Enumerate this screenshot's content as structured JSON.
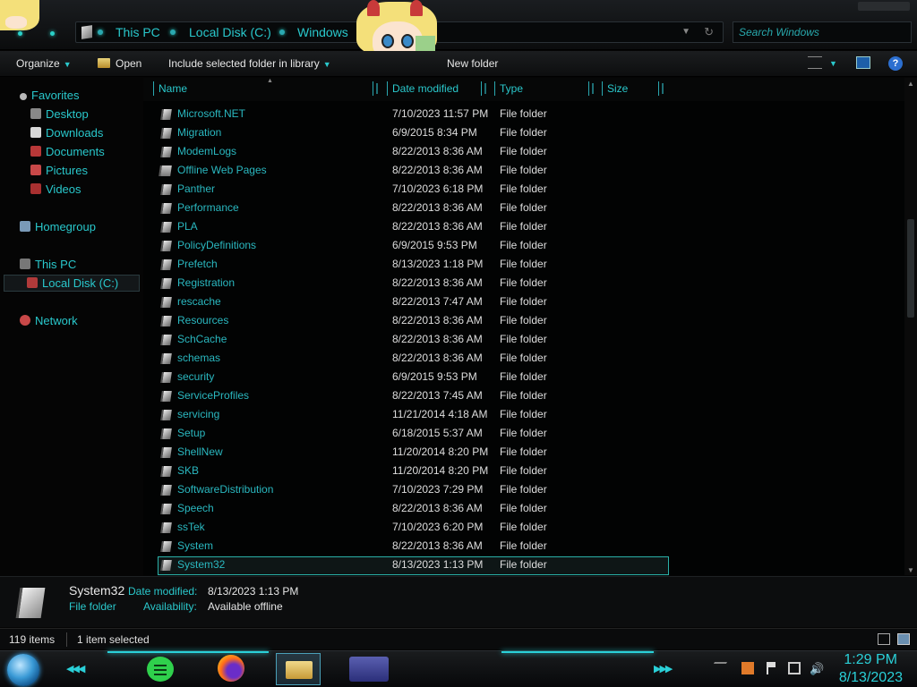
{
  "window": {
    "breadcrumb": [
      "This PC",
      "Local Disk (C:)",
      "Windows"
    ],
    "search_placeholder": "Search Windows"
  },
  "toolbar": {
    "organize": "Organize",
    "open": "Open",
    "include_library": "Include selected folder in library",
    "new_folder": "New folder"
  },
  "nav": {
    "favorites": "Favorites",
    "favorites_items": [
      "Desktop",
      "Downloads",
      "Documents",
      "Pictures",
      "Videos"
    ],
    "homegroup": "Homegroup",
    "this_pc": "This PC",
    "local_disk": "Local Disk (C:)",
    "network": "Network"
  },
  "columns": {
    "name": "Name",
    "date_modified": "Date modified",
    "type": "Type",
    "size": "Size"
  },
  "files": [
    {
      "name": "Microsoft.NET",
      "date": "7/10/2023 11:57 PM",
      "type": "File folder"
    },
    {
      "name": "Migration",
      "date": "6/9/2015 8:34 PM",
      "type": "File folder"
    },
    {
      "name": "ModemLogs",
      "date": "8/22/2013 8:36 AM",
      "type": "File folder"
    },
    {
      "name": "Offline Web Pages",
      "date": "8/22/2013 8:36 AM",
      "type": "File folder"
    },
    {
      "name": "Panther",
      "date": "7/10/2023 6:18 PM",
      "type": "File folder"
    },
    {
      "name": "Performance",
      "date": "8/22/2013 8:36 AM",
      "type": "File folder"
    },
    {
      "name": "PLA",
      "date": "8/22/2013 8:36 AM",
      "type": "File folder"
    },
    {
      "name": "PolicyDefinitions",
      "date": "6/9/2015 9:53 PM",
      "type": "File folder"
    },
    {
      "name": "Prefetch",
      "date": "8/13/2023 1:18 PM",
      "type": "File folder"
    },
    {
      "name": "Registration",
      "date": "8/22/2013 8:36 AM",
      "type": "File folder"
    },
    {
      "name": "rescache",
      "date": "8/22/2013 7:47 AM",
      "type": "File folder"
    },
    {
      "name": "Resources",
      "date": "8/22/2013 8:36 AM",
      "type": "File folder"
    },
    {
      "name": "SchCache",
      "date": "8/22/2013 8:36 AM",
      "type": "File folder"
    },
    {
      "name": "schemas",
      "date": "8/22/2013 8:36 AM",
      "type": "File folder"
    },
    {
      "name": "security",
      "date": "6/9/2015 9:53 PM",
      "type": "File folder"
    },
    {
      "name": "ServiceProfiles",
      "date": "8/22/2013 7:45 AM",
      "type": "File folder"
    },
    {
      "name": "servicing",
      "date": "11/21/2014 4:18 AM",
      "type": "File folder"
    },
    {
      "name": "Setup",
      "date": "6/18/2015 5:37 AM",
      "type": "File folder"
    },
    {
      "name": "ShellNew",
      "date": "11/20/2014 8:20 PM",
      "type": "File folder"
    },
    {
      "name": "SKB",
      "date": "11/20/2014 8:20 PM",
      "type": "File folder"
    },
    {
      "name": "SoftwareDistribution",
      "date": "7/10/2023 7:29 PM",
      "type": "File folder"
    },
    {
      "name": "Speech",
      "date": "8/22/2013 8:36 AM",
      "type": "File folder"
    },
    {
      "name": "ssTek",
      "date": "7/10/2023 6:20 PM",
      "type": "File folder"
    },
    {
      "name": "System",
      "date": "8/22/2013 8:36 AM",
      "type": "File folder"
    },
    {
      "name": "System32",
      "date": "8/13/2023 1:13 PM",
      "type": "File folder"
    }
  ],
  "selected_index": 24,
  "details": {
    "name": "System32",
    "type": "File folder",
    "date_label": "Date modified:",
    "date_value": "8/13/2023 1:13 PM",
    "availability_label": "Availability:",
    "availability_value": "Available offline"
  },
  "status": {
    "item_count": "119 items",
    "selection": "1 item selected"
  },
  "taskbar": {
    "time": "1:29 PM",
    "date": "8/13/2023"
  },
  "colors": {
    "accent": "#2ac8cc",
    "background": "#050505",
    "text": "#dedede"
  }
}
